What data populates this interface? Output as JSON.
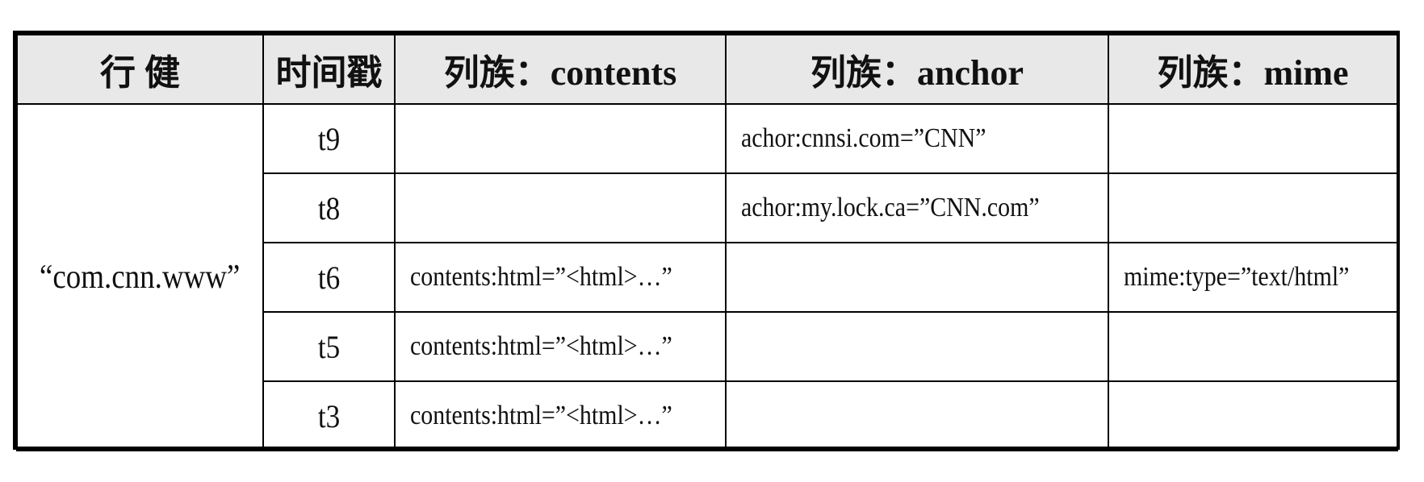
{
  "table": {
    "headers": [
      "行 健",
      "时间戳",
      "列族：contents",
      "列族：anchor",
      "列族：mime"
    ],
    "row_key": "“com.cnn.www”",
    "rows": [
      {
        "timestamp": "t9",
        "contents": "",
        "anchor": "achor:cnnsi.com=”CNN”",
        "mime": ""
      },
      {
        "timestamp": "t8",
        "contents": "",
        "anchor": "achor:my.lock.ca=”CNN.com”",
        "mime": ""
      },
      {
        "timestamp": "t6",
        "contents": "contents:html=”<html>…”",
        "anchor": "",
        "mime": "mime:type=”text/html”"
      },
      {
        "timestamp": "t5",
        "contents": "contents:html=”<html>…”",
        "anchor": "",
        "mime": ""
      },
      {
        "timestamp": "t3",
        "contents": "contents:html=”<html>…”",
        "anchor": "",
        "mime": ""
      }
    ]
  }
}
